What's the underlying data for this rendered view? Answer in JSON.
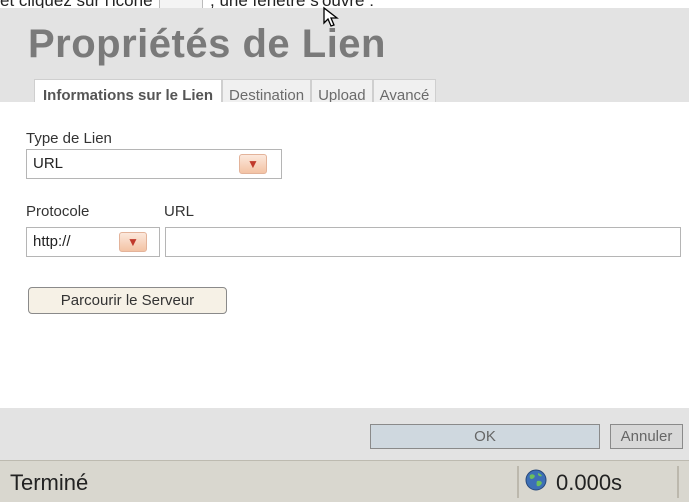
{
  "caption": {
    "before": "et cliquez sur l'icône",
    "after": ", une fenêtre s'ouvre :"
  },
  "dialog": {
    "title": "Propriétés de Lien",
    "tabs": [
      {
        "label": "Informations sur le Lien",
        "active": true
      },
      {
        "label": "Destination",
        "active": false
      },
      {
        "label": "Upload",
        "active": false
      },
      {
        "label": "Avancé",
        "active": false
      }
    ],
    "link_type": {
      "label": "Type de Lien",
      "value": "URL"
    },
    "protocol": {
      "label": "Protocole",
      "value": "http://"
    },
    "url": {
      "label": "URL",
      "value": ""
    },
    "browse_button": "Parcourir le Serveur",
    "ok_button": "OK",
    "cancel_button": "Annuler"
  },
  "statusbar": {
    "text": "Terminé",
    "time": "0.000s",
    "icon": "globe-icon"
  }
}
